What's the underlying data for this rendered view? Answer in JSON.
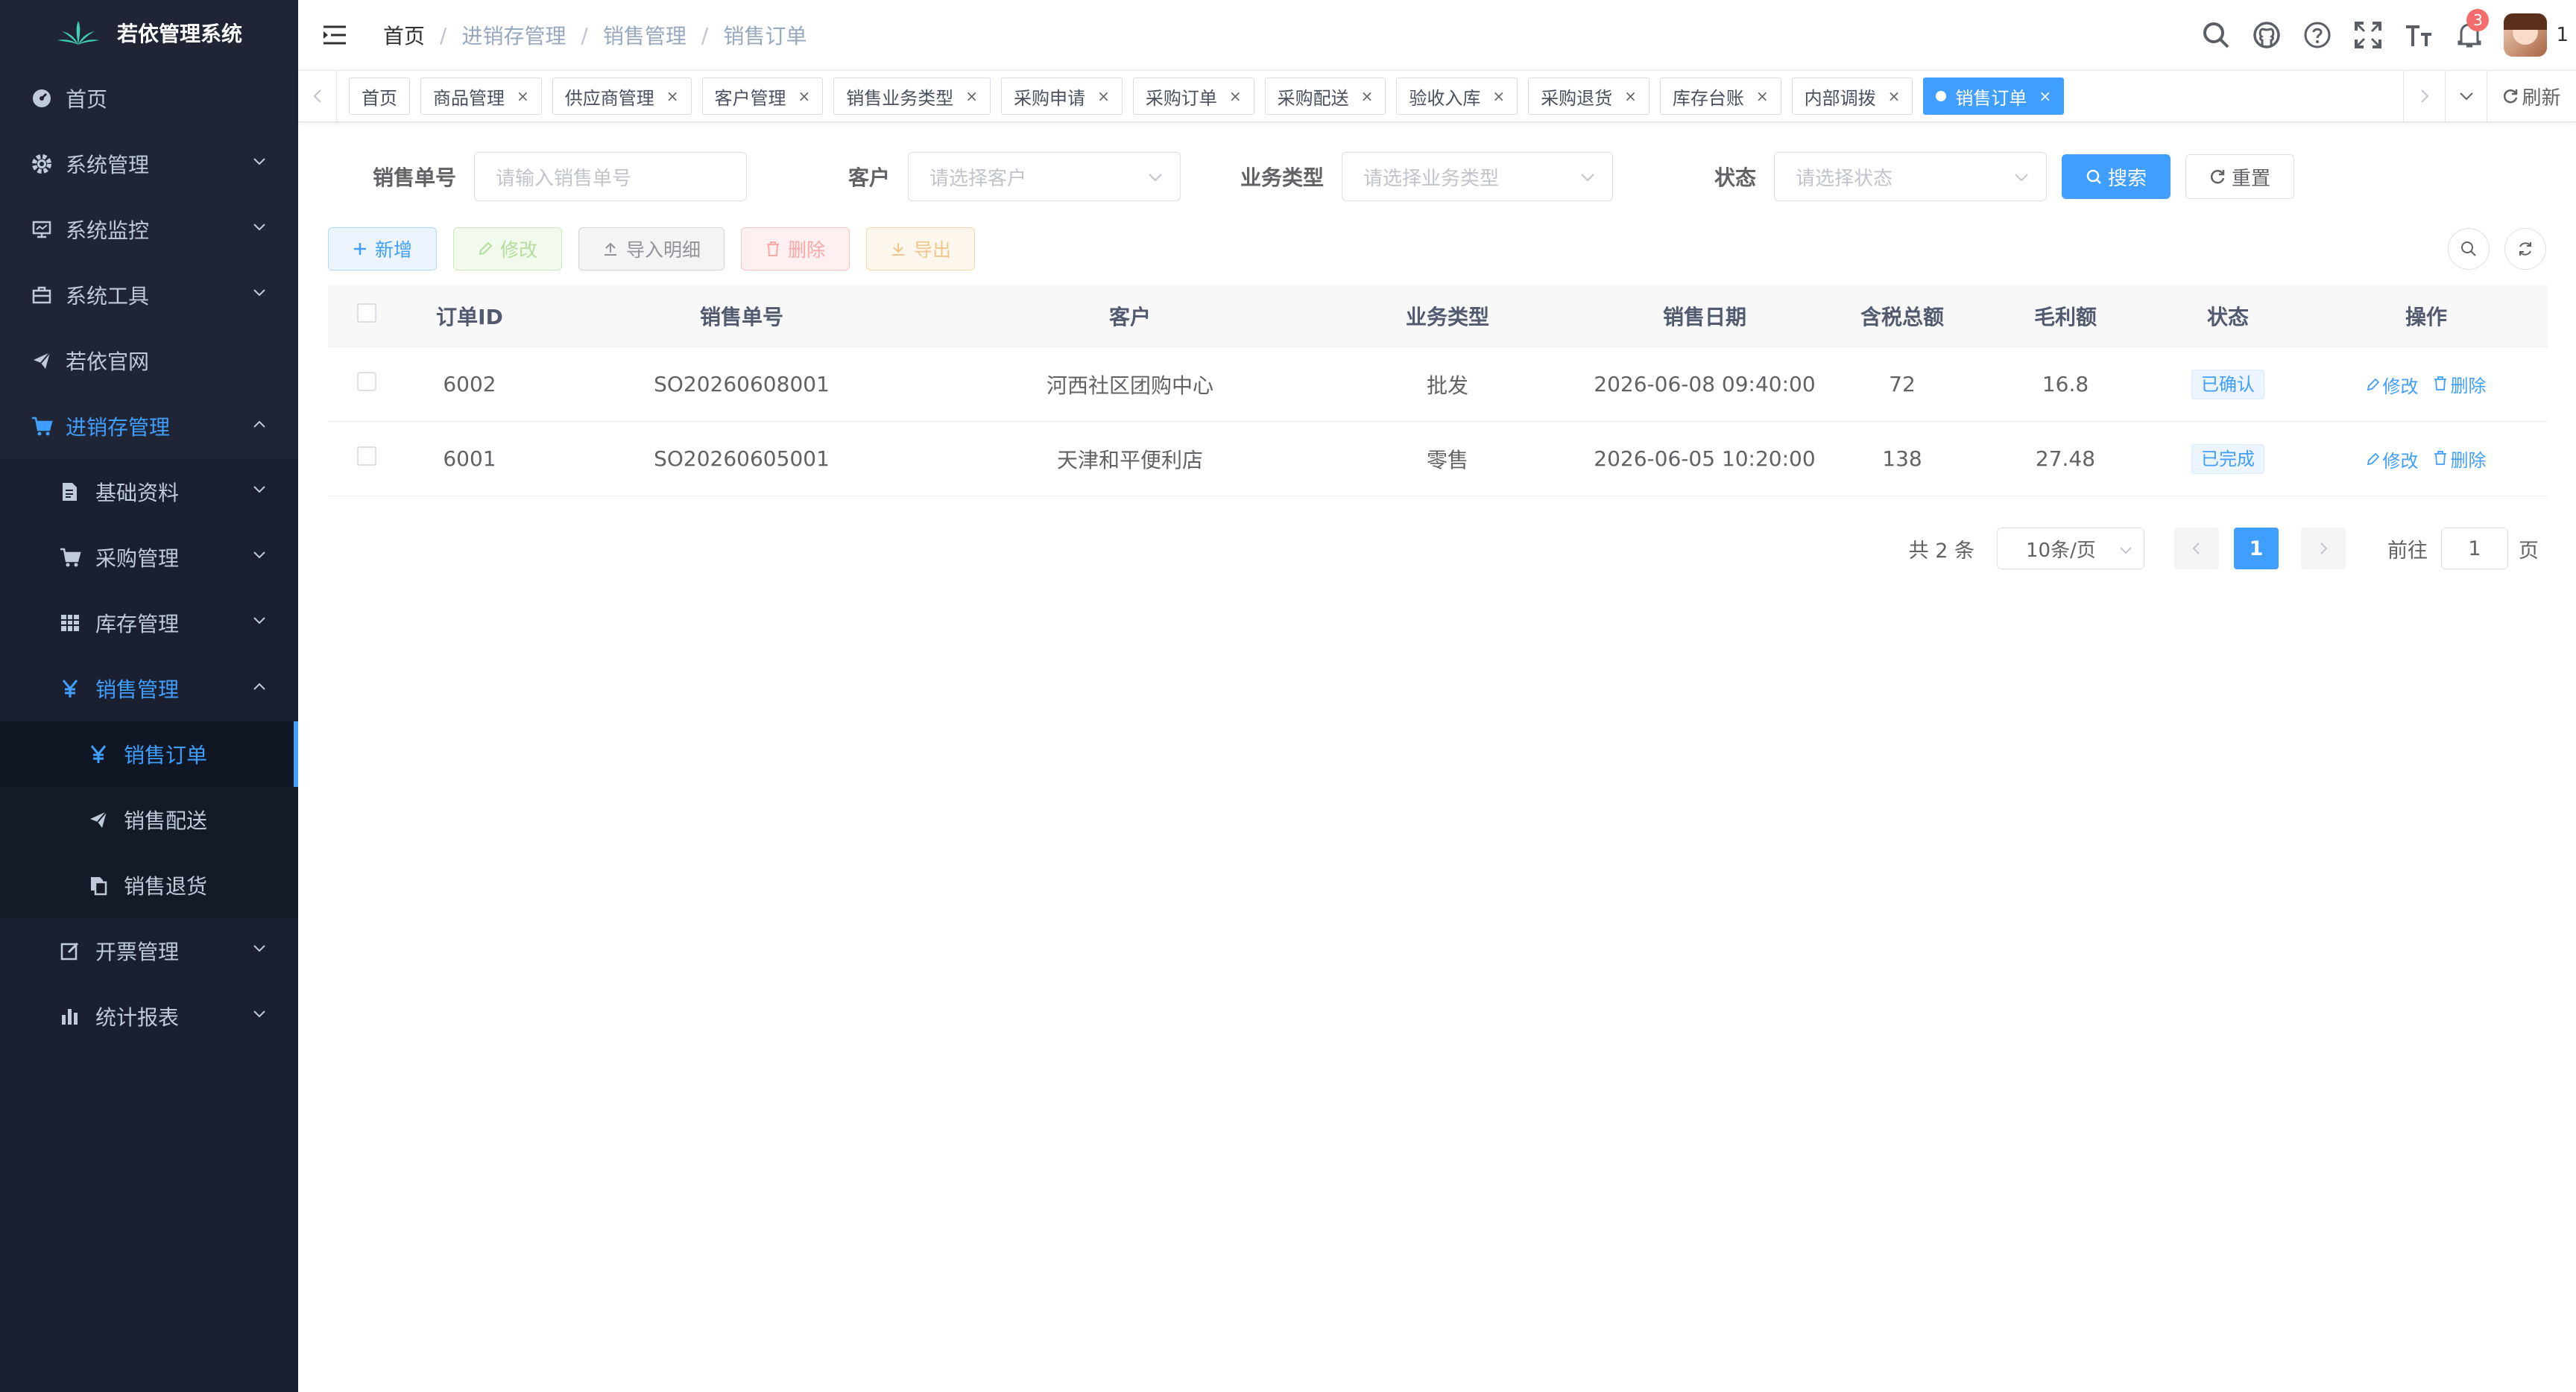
{
  "app": {
    "title": "若依管理系统"
  },
  "sidebar": {
    "items": [
      {
        "label": "首页",
        "icon": "dashboard-icon"
      },
      {
        "label": "系统管理",
        "icon": "gear-icon"
      },
      {
        "label": "系统监控",
        "icon": "monitor-icon"
      },
      {
        "label": "系统工具",
        "icon": "toolbox-icon"
      },
      {
        "label": "若依官网",
        "icon": "send-icon"
      },
      {
        "label": "进销存管理",
        "icon": "cart-icon"
      }
    ],
    "sub": [
      {
        "label": "基础资料",
        "icon": "document-icon"
      },
      {
        "label": "采购管理",
        "icon": "cart-icon"
      },
      {
        "label": "库存管理",
        "icon": "grid-icon"
      },
      {
        "label": "销售管理",
        "icon": "yen-icon"
      }
    ],
    "sales": [
      {
        "label": "销售订单",
        "icon": "yen-icon"
      },
      {
        "label": "销售配送",
        "icon": "send-icon"
      },
      {
        "label": "销售退货",
        "icon": "copy-icon"
      }
    ],
    "after": [
      {
        "label": "开票管理",
        "icon": "edit-icon"
      },
      {
        "label": "统计报表",
        "icon": "bar-chart-icon"
      }
    ]
  },
  "header": {
    "breadcrumb": [
      "首页",
      "进销存管理",
      "销售管理",
      "销售订单"
    ],
    "notification_count": "3",
    "user_name": "1"
  },
  "tags": [
    "首页",
    "商品管理",
    "供应商管理",
    "客户管理",
    "销售业务类型",
    "采购申请",
    "采购订单",
    "采购配送",
    "验收入库",
    "采购退货",
    "库存台账",
    "内部调拨",
    "销售订单"
  ],
  "tags_refresh": "刷新",
  "search": {
    "order_no_label": "销售单号",
    "order_no_placeholder": "请输入销售单号",
    "customer_label": "客户",
    "customer_placeholder": "请选择客户",
    "biz_type_label": "业务类型",
    "biz_type_placeholder": "请选择业务类型",
    "status_label": "状态",
    "status_placeholder": "请选择状态",
    "search_btn": "搜索",
    "reset_btn": "重置"
  },
  "toolbar": {
    "add": "新增",
    "edit": "修改",
    "import": "导入明细",
    "delete": "删除",
    "export": "导出"
  },
  "table": {
    "headers": [
      "订单ID",
      "销售单号",
      "客户",
      "业务类型",
      "销售日期",
      "含税总额",
      "毛利额",
      "状态",
      "操作"
    ],
    "rows": [
      {
        "id": "6002",
        "order_no": "SO20260608001",
        "customer": "河西社区团购中心",
        "biz_type": "批发",
        "date": "2026-06-08 09:40:00",
        "total": "72",
        "profit": "16.8",
        "status": "已确认"
      },
      {
        "id": "6001",
        "order_no": "SO20260605001",
        "customer": "天津和平便利店",
        "biz_type": "零售",
        "date": "2026-06-05 10:20:00",
        "total": "138",
        "profit": "27.48",
        "status": "已完成"
      }
    ],
    "op_edit": "修改",
    "op_delete": "删除"
  },
  "pagination": {
    "total_text": "共 2 条",
    "page_size": "10条/页",
    "current_page": "1",
    "goto_label": "前往",
    "goto_value": "1",
    "page_unit": "页"
  },
  "colors": {
    "primary": "#409eff",
    "sidebar_bg": "#1f2535",
    "sidebar_active": "#409eff"
  }
}
